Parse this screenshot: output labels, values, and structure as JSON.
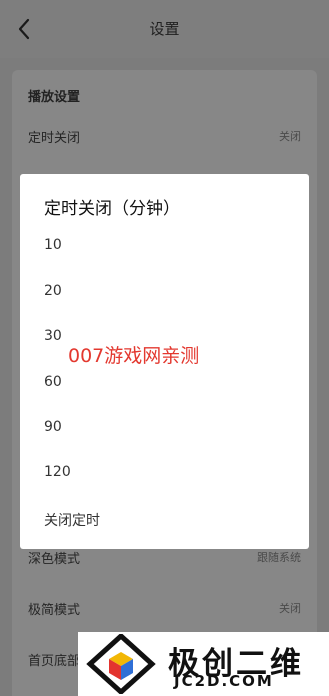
{
  "header": {
    "title": "设置",
    "back_icon": "chevron-left-icon"
  },
  "settings": {
    "section_title": "播放设置",
    "rows": [
      {
        "label": "定时关闭",
        "value": "关闭"
      },
      {
        "label": "深色模式",
        "value": "跟随系统"
      },
      {
        "label": "极简模式",
        "value": "关闭"
      },
      {
        "label": "首页底部",
        "value": ""
      }
    ]
  },
  "dialog": {
    "title": "定时关闭（分钟）",
    "options": [
      "10",
      "20",
      "30",
      "60",
      "90",
      "120",
      "关闭定时"
    ]
  },
  "watermark": "007游戏网亲测",
  "logo": {
    "text": "极创二维",
    "sub": "JC2D.COM"
  },
  "colors": {
    "watermark": "#e3382f",
    "overlay": "#7c7c7c",
    "dialog_bg": "#ffffff"
  }
}
